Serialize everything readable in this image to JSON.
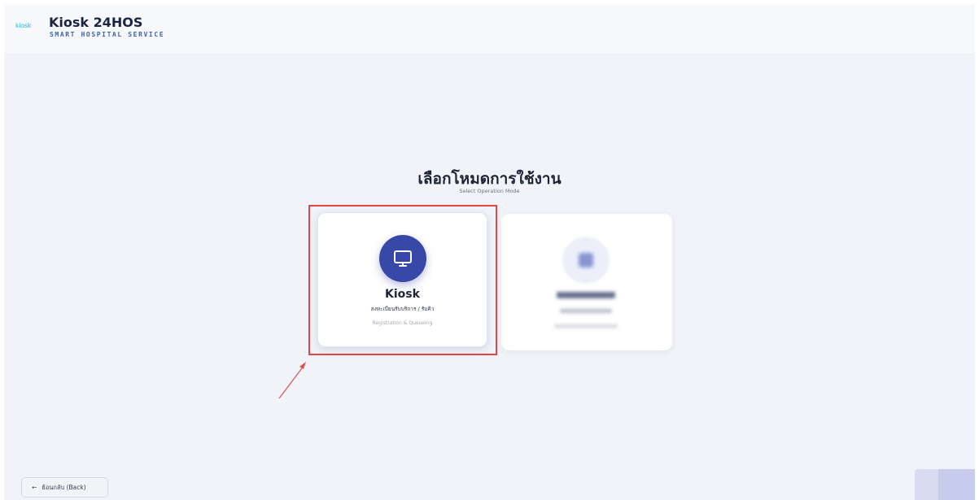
{
  "header": {
    "logo_text": "kiosk",
    "brand_title": "Kiosk 24HOS",
    "brand_subtitle": "SMART HOSPITAL SERVICE"
  },
  "main": {
    "title": "เลือกโหมดการใช้งาน",
    "subtitle": "Select Operation Mode",
    "cards": [
      {
        "icon": "monitor-icon",
        "title": "Kiosk",
        "subtitle_th": "ลงทะเบียนรับบริการ / รับคิว",
        "subtitle_en": "Registration & Queueing",
        "highlighted": true
      },
      {
        "icon": "blurred-icon",
        "obscured": true
      }
    ]
  },
  "footer": {
    "back_label": "ย้อนกลับ (Back)",
    "back_icon": "arrow-left-icon"
  },
  "colors": {
    "accent": "#3748a8",
    "highlight": "#e24747",
    "background": "#f1f3f8"
  }
}
